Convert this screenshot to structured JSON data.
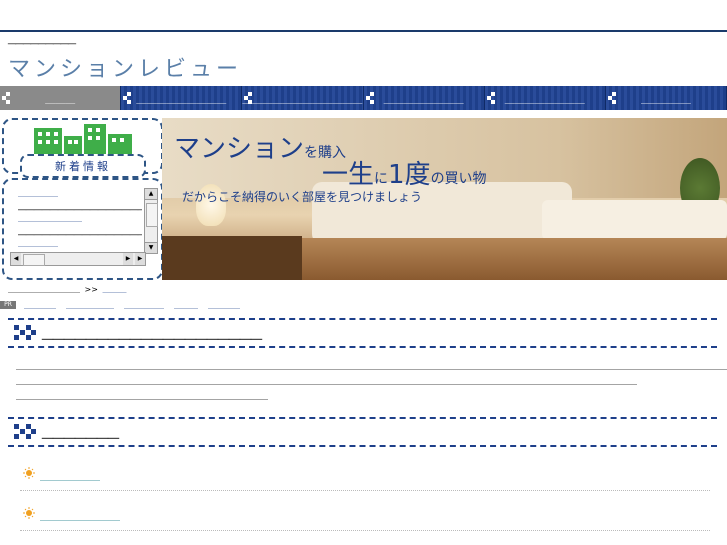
{
  "header": {
    "tagline": "＿＿＿＿＿＿＿＿＿",
    "site_title": "マンションレビュー"
  },
  "nav": {
    "items": [
      {
        "label": "＿＿＿",
        "active": true
      },
      {
        "label": "＿＿＿＿＿＿＿＿＿",
        "active": false
      },
      {
        "label": "＿＿＿＿＿＿＿＿＿＿＿＿",
        "active": false
      },
      {
        "label": "＿＿＿＿＿＿＿＿",
        "active": false
      },
      {
        "label": "＿＿＿＿＿＿＿＿",
        "active": false
      },
      {
        "label": "＿＿＿＿＿",
        "active": false
      }
    ]
  },
  "news": {
    "title": "新着情報",
    "items": [
      {
        "text": "＿＿＿＿＿",
        "type": "link"
      },
      {
        "text": "＿＿＿＿＿＿＿＿＿＿＿＿＿＿＿＿",
        "type": "text"
      },
      {
        "text": "＿＿＿＿＿＿＿＿",
        "type": "link"
      },
      {
        "text": "＿＿＿＿＿＿＿＿＿＿＿＿＿＿＿＿＿＿＿＿＿",
        "type": "text"
      },
      {
        "text": "＿＿＿＿＿",
        "type": "link"
      }
    ]
  },
  "banner": {
    "line1_main": "マンション",
    "line1_small": "を購入",
    "line2_a": "一生",
    "line2_b": "に",
    "line2_c": "1度",
    "line2_d": "の買い物",
    "line3": "だからこそ納得のいく部屋を見つけましょう"
  },
  "breadcrumb": {
    "home": "＿＿＿＿＿＿＿＿＿",
    "separator": ">>",
    "current": "＿＿＿"
  },
  "pr": {
    "badge": "PR",
    "links": [
      "＿＿＿＿",
      "＿＿＿＿＿＿",
      "＿＿＿＿＿",
      "＿＿＿",
      "＿＿＿＿"
    ]
  },
  "sections": [
    {
      "title": "＿＿＿＿＿＿＿＿＿＿＿＿＿＿＿＿＿＿＿＿",
      "body": [
        "＿＿＿＿＿＿＿＿＿＿＿＿＿＿＿＿＿＿＿＿＿＿＿＿＿＿＿＿＿＿＿＿＿＿＿＿＿＿＿＿＿＿＿＿＿＿＿＿＿＿＿＿＿＿＿＿＿＿＿＿＿＿＿＿＿＿＿＿＿＿＿＿＿＿＿＿＿＿＿",
        "＿＿＿＿＿＿＿＿＿＿＿＿＿＿＿＿＿＿＿＿＿＿＿＿＿＿＿＿＿＿＿＿＿＿＿＿＿＿＿＿＿＿＿＿＿＿＿＿＿＿＿＿＿＿＿＿＿＿＿＿＿＿＿＿＿＿＿＿＿",
        "＿＿＿＿＿＿＿＿＿＿＿＿＿＿＿＿＿＿＿＿＿＿＿＿＿＿＿＿"
      ]
    },
    {
      "title": "＿＿＿＿＿＿＿",
      "items": [
        "＿＿＿＿＿＿",
        "＿＿＿＿＿＿＿＿"
      ]
    }
  ],
  "colors": {
    "nav_bg": "#1e3f8a",
    "accent": "#1e3f8a",
    "link_teal": "#1e7f8a"
  }
}
